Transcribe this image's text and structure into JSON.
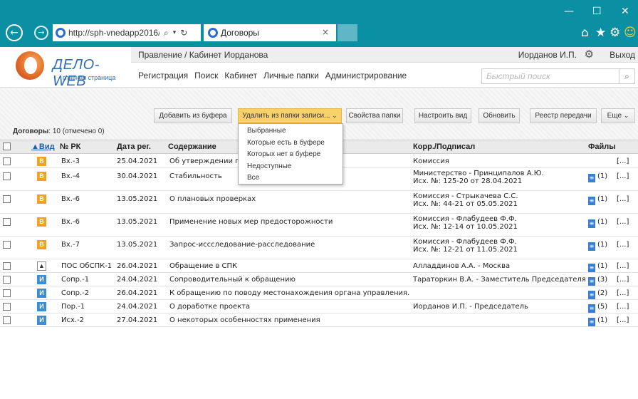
{
  "browser": {
    "url": "http://sph-vnedapp2016/l",
    "tab_title": "Договоры",
    "controls": {
      "minimize": "—",
      "maximize": "☐",
      "close": "✕"
    }
  },
  "app": {
    "logo_title": "ДЕЛО-WEB",
    "logo_subtitle": "главная страница",
    "breadcrumb": "Правление / Кабинет Иорданова",
    "user": "Иорданов И.П.",
    "logout": "Выход",
    "menu": [
      "Регистрация",
      "Поиск",
      "Кабинет",
      "Личные папки",
      "Администрирование"
    ],
    "search_placeholder": "Быстрый поиск"
  },
  "toolbar": {
    "add_from_buffer": "Добавить из буфера",
    "delete_from_folder": "Удалить из папки записи...",
    "folder_properties": "Свойства папки",
    "configure_view": "Настроить вид",
    "refresh": "Обновить",
    "transfer_registry": "Реестр передачи",
    "more": "Еще"
  },
  "summary": {
    "label": "Договоры",
    "count": ": 10 (отмечено 0)"
  },
  "dropdown": {
    "items": [
      "Выбранные",
      "Которые есть в буфере",
      "Которых нет в буфере",
      "Недоступные",
      "Все"
    ]
  },
  "table": {
    "headers": {
      "type": "▲Вид",
      "number": "№ РК",
      "date": "Дата рег.",
      "content": "Содержание",
      "corr": "Корр./Подписал",
      "files": "Файлы"
    },
    "rows": [
      {
        "type": "В",
        "kind": "b",
        "number": "Вх.-3",
        "date": "25.04.2021",
        "content": "Об утверждении по",
        "corr": "Комиссия",
        "corr2": "",
        "files": "",
        "more": "[...]"
      },
      {
        "type": "В",
        "kind": "b",
        "number": "Вх.-4",
        "date": "30.04.2021",
        "content": "Стабильность",
        "corr": "Министерство - Принципалов А.Ю.",
        "corr2": "Исх. №: 125-20 от 28.04.2021",
        "files": "(1)",
        "more": "[...]"
      },
      {
        "type": "В",
        "kind": "b",
        "number": "Вх.-6",
        "date": "13.05.2021",
        "content": "О плановых проверках",
        "corr": "Комиссия - Стрыкачева С.С.",
        "corr2": "Исх. №: 44-21 от 05.05.2021",
        "files": "(1)",
        "more": "[...]"
      },
      {
        "type": "В",
        "kind": "b",
        "number": "Вх.-6",
        "date": "13.05.2021",
        "content": "Применение новых мер предосторожности",
        "corr": "Комиссия - Флабудеев Ф.Ф.",
        "corr2": "Исх. №: 12-14 от 10.05.2021",
        "files": "(1)",
        "more": "[...]"
      },
      {
        "type": "В",
        "kind": "b",
        "number": "Вх.-7",
        "date": "13.05.2021",
        "content": "Запрос-иссследование-расследование",
        "corr": "Комиссия - Флабудеев Ф.Ф.",
        "corr2": "Исх. №: 12-21 от 11.05.2021",
        "files": "(1)",
        "more": "[...]"
      },
      {
        "type": "",
        "kind": "p",
        "number": "ПОС ОбСПК-1",
        "date": "26.04.2021",
        "content": "Обращение в СПК",
        "corr": "Алладдинов А.А. - Москва",
        "corr2": "",
        "files": "(1)",
        "more": "[...]"
      },
      {
        "type": "И",
        "kind": "i",
        "number": "Сопр.-1",
        "date": "24.04.2021",
        "content": "Сопроводительный к обращению",
        "corr": "Тараторкин В.А. - Заместитель Председателя",
        "corr2": "",
        "files": "(3)",
        "more": "[...]"
      },
      {
        "type": "И",
        "kind": "i",
        "number": "Сопр.-2",
        "date": "26.04.2021",
        "content": "К обращению по поводу местонахождения органа управления.",
        "corr": "",
        "corr2": "",
        "files": "(2)",
        "more": "[...]"
      },
      {
        "type": "И",
        "kind": "i",
        "number": "Пор.-1",
        "date": "24.04.2021",
        "content": "О доработке проекта",
        "corr": "Иорданов И.П. - Председатель",
        "corr2": "",
        "files": "(5)",
        "more": "[...]"
      },
      {
        "type": "И",
        "kind": "i",
        "number": "Исх.-2",
        "date": "27.04.2021",
        "content": "О некоторых особенностях применения",
        "corr": "",
        "corr2": "",
        "files": "(1)",
        "more": "[...]"
      }
    ]
  }
}
